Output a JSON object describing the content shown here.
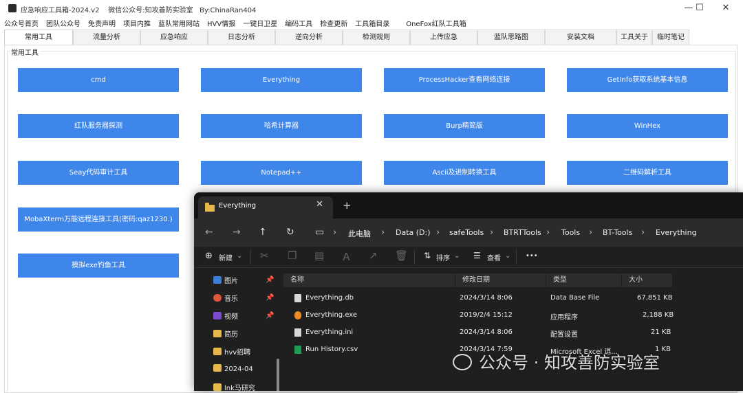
{
  "window": {
    "title": "应急响应工具箱-2024.v2    微信公众号:知攻善防实验室   By:ChinaRan404",
    "min": "—",
    "max": "☐",
    "close": "✕"
  },
  "menu": [
    "公众号首页",
    "团队公众号",
    "免责声明",
    "项目内推",
    "蓝队常用网站",
    "HVV情报",
    "一键日卫星",
    "编码工具",
    "检查更新",
    "工具箱目录",
    "OneFox红队工具箱"
  ],
  "tabs": [
    "常用工具",
    "流量分析",
    "应急响应",
    "日志分析",
    "逆向分析",
    "检测规则",
    "上传应急",
    "蓝队思路图",
    "安装文档",
    "工具关于",
    "临时笔记"
  ],
  "group_label": "常用工具",
  "tools": [
    "cmd",
    "Everything",
    "ProcessHacker查看网络连接",
    "GetInfo获取系统基本信息",
    "红队服务器探测",
    "哈希计算器",
    "Burp精简版",
    "WinHex",
    "Seay代码审计工具",
    "Notepad++",
    "Ascii及进制转换工具",
    "二维码解析工具",
    "MobaXterm万能远程连接工具(密码:qaz1230.)",
    "模拟exe钓鱼工具"
  ],
  "explorer": {
    "tab_title": "Everything",
    "tab_close": "✕",
    "new_tab": "+",
    "breadcrumb": [
      "此电脑",
      "Data (D:)",
      "safeTools",
      "BTRTTools",
      "Tools",
      "BT-Tools",
      "Everything"
    ],
    "commands": {
      "new": "新建",
      "sort": "排序",
      "view": "查看",
      "more": "•••"
    },
    "nav_items": [
      {
        "label": "图片",
        "color": "#3b7fd9",
        "pinned": true
      },
      {
        "label": "音乐",
        "color": "#e0563c",
        "pinned": true
      },
      {
        "label": "视频",
        "color": "#7a4bd1",
        "pinned": true
      },
      {
        "label": "简历",
        "color": "#e6b84a",
        "pinned": false
      },
      {
        "label": "hvv招聘",
        "color": "#e6b84a",
        "pinned": false
      },
      {
        "label": "2024-04",
        "color": "#e6b84a",
        "pinned": false
      },
      {
        "label": "lnk马研究",
        "color": "#e6b84a",
        "pinned": false
      }
    ],
    "columns": [
      "名称",
      "修改日期",
      "类型",
      "大小"
    ],
    "files": [
      {
        "name": "Everything.db",
        "date": "2024/3/14 8:06",
        "type": "Data Base File",
        "size": "67,851 KB",
        "icon_color": "#d8d8d8"
      },
      {
        "name": "Everything.exe",
        "date": "2019/2/4 15:12",
        "type": "应用程序",
        "size": "2,188 KB",
        "icon_color": "#f08a24"
      },
      {
        "name": "Everything.ini",
        "date": "2024/3/14 8:06",
        "type": "配置设置",
        "size": "21 KB",
        "icon_color": "#d8d8d8"
      },
      {
        "name": "Run History.csv",
        "date": "2024/3/14 7:59",
        "type": "Microsoft Excel 逗...",
        "size": "1 KB",
        "icon_color": "#1f9d55"
      }
    ]
  },
  "watermark": "公众号 · 知攻善防实验室"
}
